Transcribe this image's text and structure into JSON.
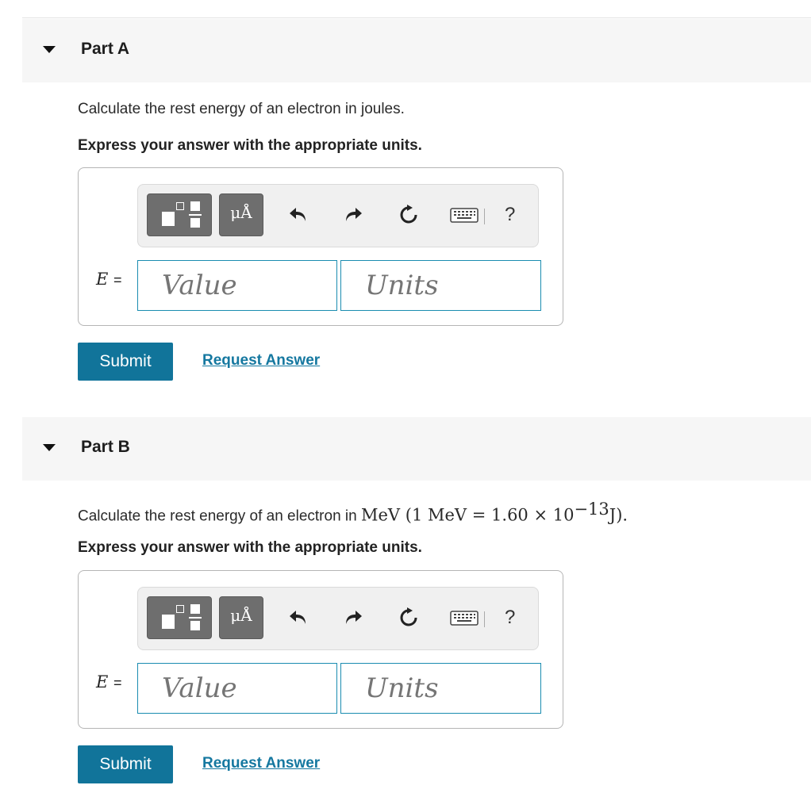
{
  "parts": [
    {
      "title": "Part A",
      "question_text": "Calculate the rest energy of an electron in joules.",
      "instruction": "Express your answer with the appropriate units.",
      "toolbar": {
        "units_button_label": "μÅ",
        "help_label": "?"
      },
      "variable": "E",
      "equals": "=",
      "value_placeholder": "Value",
      "units_placeholder": "Units",
      "submit_label": "Submit",
      "request_label": "Request Answer"
    },
    {
      "title": "Part B",
      "question_prefix": "Calculate the rest energy of an electron in ",
      "question_math": "MeV (1 MeV = 1.60 × 10",
      "question_exponent": "−13",
      "question_math_end": "J).",
      "instruction": "Express your answer with the appropriate units.",
      "toolbar": {
        "units_button_label": "μÅ",
        "help_label": "?"
      },
      "variable": "E",
      "equals": "=",
      "value_placeholder": "Value",
      "units_placeholder": "Units",
      "submit_label": "Submit",
      "request_label": "Request Answer"
    }
  ],
  "colors": {
    "accent": "#11749a",
    "link": "#1578a0",
    "input_border": "#1a8cb0",
    "toolbar_button": "#6e6e6e",
    "header_bg": "#f6f6f6"
  },
  "icons": [
    "caret-down-icon",
    "templates-icon",
    "undo-icon",
    "redo-icon",
    "reset-icon",
    "keyboard-icon"
  ]
}
